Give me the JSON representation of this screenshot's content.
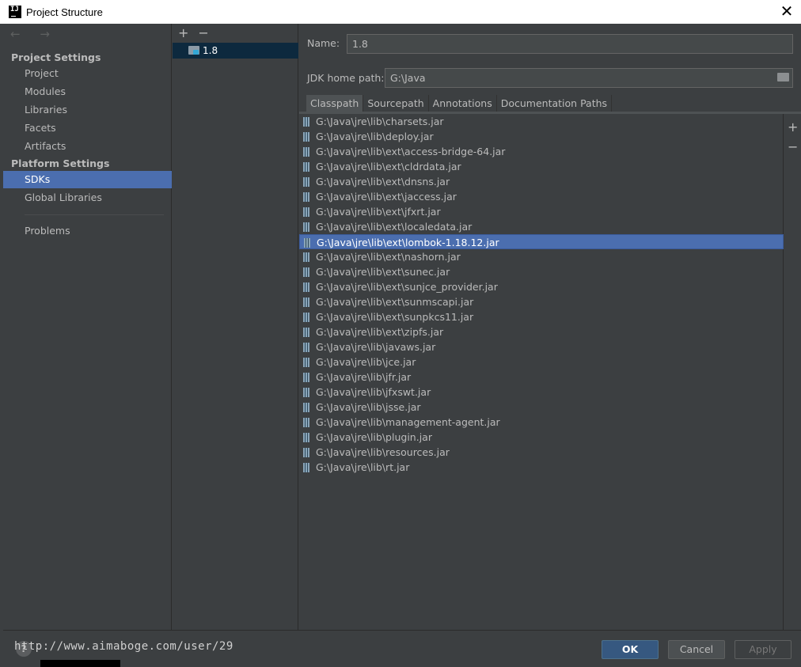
{
  "window": {
    "title": "Project Structure",
    "close_glyph": "✕"
  },
  "nav": {
    "back_forward": "← →",
    "project_settings_title": "Project Settings",
    "project_items": [
      "Project",
      "Modules",
      "Libraries",
      "Facets",
      "Artifacts"
    ],
    "platform_settings_title": "Platform Settings",
    "platform_items": [
      "SDKs",
      "Global Libraries"
    ],
    "selected": "SDKs",
    "problems": "Problems"
  },
  "sdk_list": {
    "add": "+",
    "remove": "−",
    "items": [
      "1.8"
    ]
  },
  "details": {
    "name_label": "Name:",
    "name_value": "1.8",
    "jdk_home_label": "JDK home path:",
    "jdk_home_value": "G:\\Java",
    "tabs": [
      "Classpath",
      "Sourcepath",
      "Annotations",
      "Documentation Paths"
    ],
    "active_tab": "Classpath",
    "classpath": [
      "G:\\Java\\jre\\lib\\charsets.jar",
      "G:\\Java\\jre\\lib\\deploy.jar",
      "G:\\Java\\jre\\lib\\ext\\access-bridge-64.jar",
      "G:\\Java\\jre\\lib\\ext\\cldrdata.jar",
      "G:\\Java\\jre\\lib\\ext\\dnsns.jar",
      "G:\\Java\\jre\\lib\\ext\\jaccess.jar",
      "G:\\Java\\jre\\lib\\ext\\jfxrt.jar",
      "G:\\Java\\jre\\lib\\ext\\localedata.jar",
      "G:\\Java\\jre\\lib\\ext\\lombok-1.18.12.jar",
      "G:\\Java\\jre\\lib\\ext\\nashorn.jar",
      "G:\\Java\\jre\\lib\\ext\\sunec.jar",
      "G:\\Java\\jre\\lib\\ext\\sunjce_provider.jar",
      "G:\\Java\\jre\\lib\\ext\\sunmscapi.jar",
      "G:\\Java\\jre\\lib\\ext\\sunpkcs11.jar",
      "G:\\Java\\jre\\lib\\ext\\zipfs.jar",
      "G:\\Java\\jre\\lib\\javaws.jar",
      "G:\\Java\\jre\\lib\\jce.jar",
      "G:\\Java\\jre\\lib\\jfr.jar",
      "G:\\Java\\jre\\lib\\jfxswt.jar",
      "G:\\Java\\jre\\lib\\jsse.jar",
      "G:\\Java\\jre\\lib\\management-agent.jar",
      "G:\\Java\\jre\\lib\\plugin.jar",
      "G:\\Java\\jre\\lib\\resources.jar",
      "G:\\Java\\jre\\lib\\rt.jar"
    ],
    "selected_index": 8,
    "add": "+",
    "remove": "−"
  },
  "footer": {
    "help": "?",
    "watermark": "http://www.aimaboge.com/user/29",
    "ok": "OK",
    "cancel": "Cancel",
    "apply": "Apply"
  },
  "colors": {
    "selection": "#4b6eaf",
    "ok_button": "#365880",
    "background": "#3c3f41"
  }
}
